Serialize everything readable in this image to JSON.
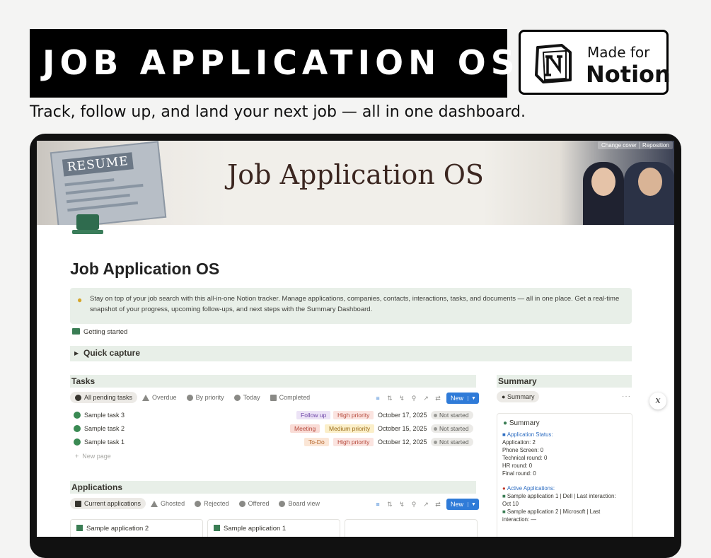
{
  "banner": {
    "title": "JOB APPLICATION OS",
    "badge_line1": "Made for",
    "badge_line2": "Notion",
    "tagline": "Track, follow up, and land your next job — all in one dashboard."
  },
  "cover": {
    "title": "Job Application OS",
    "paper_label": "RESUME",
    "change_cover": "Change cover",
    "reposition": "Reposition"
  },
  "page": {
    "title": "Job Application OS",
    "callout": "Stay on top of your job search with this all-in-one Notion tracker. Manage applications, companies, contacts, interactions, tasks, and documents — all in one place. Get a real-time snapshot of your progress, upcoming follow-ups, and next steps with the Summary Dashboard.",
    "getting_started": "Getting started",
    "quick_capture": "Quick capture"
  },
  "tasks": {
    "heading": "Tasks",
    "tabs": [
      "All pending tasks",
      "Overdue",
      "By priority",
      "Today",
      "Completed"
    ],
    "new_label": "New",
    "new_page": "New page",
    "rows": [
      {
        "name": "Sample task 3",
        "type": "Follow up",
        "priority": "High priority",
        "date": "October 17, 2025",
        "status": "Not started"
      },
      {
        "name": "Sample task 2",
        "type": "Meeting",
        "priority": "Medium priority",
        "date": "October 15, 2025",
        "status": "Not started"
      },
      {
        "name": "Sample task 1",
        "type": "To-Do",
        "priority": "High priority",
        "date": "October 12, 2025",
        "status": "Not started"
      }
    ]
  },
  "applications": {
    "heading": "Applications",
    "tabs": [
      "Current applications",
      "Ghosted",
      "Rejected",
      "Offered",
      "Board view"
    ],
    "new_label": "New",
    "cards": [
      "Sample application 2",
      "Sample application 1"
    ]
  },
  "summary": {
    "heading": "Summary",
    "tab": "Summary",
    "panel_title": "Summary",
    "status_heading": "Application Status:",
    "status_lines": [
      "Application: 2",
      "Phone Screen: 0",
      "Technical round: 0",
      "HR round: 0",
      "Final round: 0"
    ],
    "active_heading": "Active Applications:",
    "active_lines": [
      "Sample application 1 | Dell | Last interaction:",
      "Oct 10",
      "Sample application 2 | Microsoft | Last",
      "interaction: —"
    ]
  },
  "colors": {
    "accent": "#2f7bd8",
    "callout_bg": "#e8efe8",
    "done_check": "#3a8a53"
  }
}
